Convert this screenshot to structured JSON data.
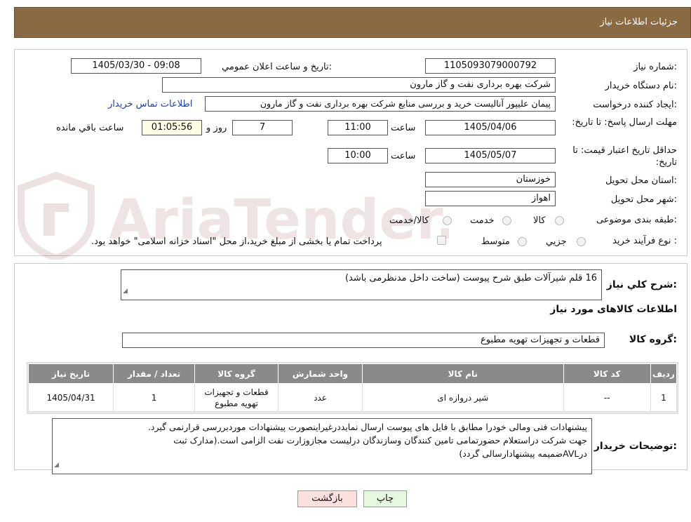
{
  "header": {
    "title": "جزئیات اطلاعات نیاز"
  },
  "watermark": {
    "text": "AriaTender.neT"
  },
  "form": {
    "need_number_label": "شماره نیاز:",
    "need_number": "1105093079000792",
    "announce_label": "تاریخ و ساعت اعلان عمومي:",
    "announce_value": "1405/03/30 - 09:08",
    "buyer_org_label": "نام دستگاه خریدار:",
    "buyer_org": "شرکت بهره برداری نفت و گاز مارون",
    "creator_label": "ایجاد کننده درخواست:",
    "creator": "پیمان علیپور آنالیست خرید و بررسی منابع شرکت بهره برداری نفت و گاز مارون",
    "contact_link": "اطلاعات تماس خریدار",
    "deadline_label": "مهلت ارسال پاسخ: تا تاریخ:",
    "deadline_date": "1405/04/06",
    "time_label": "ساعت",
    "deadline_time": "11:00",
    "days": "7",
    "days_label": "روز و",
    "remaining": "01:05:56",
    "remaining_label": "ساعت باقي مانده",
    "validity_label": "حداقل تاریخ اعتبار قیمت: تا تاریخ:",
    "validity_date": "1405/05/07",
    "validity_time": "10:00",
    "province_label": "استان محل تحویل:",
    "province": "خوزستان",
    "city_label": "شهر محل تحویل:",
    "city": "اهواز",
    "category_label": "طبقه بندی موضوعی:",
    "category_options": [
      "کالا",
      "خدمت",
      "کالا/خدمت"
    ],
    "process_label": "نوع فرآیند خرید :",
    "process_options": [
      "جزیي",
      "متوسط"
    ],
    "payment_note": "پرداخت تمام یا بخشی از مبلغ خرید،از محل \"اسناد خزانه اسلامی\" خواهد بود."
  },
  "summary": {
    "description_label": "شرح کلي نیاز:",
    "description": "16 قلم شیرآلات طبق شرح پیوست (ساخت داخل مدنظرمی باشد)",
    "goods_info_title": "اطلاعات کالاهای مورد نیاز",
    "goods_group_label": "گروه کالا:",
    "goods_group": "قطعات و تجهیزات تهویه مطبوع"
  },
  "table": {
    "headers": [
      "ردیف",
      "کد کالا",
      "نام کالا",
      "واحد شمارش",
      "گروه کالا",
      "تعداد / مقدار",
      "تاریخ نیاز"
    ],
    "rows": [
      [
        "1",
        "--",
        "شیر دروازه ای",
        "عدد",
        "قطعات و تجهیزات تهویه مطبوع",
        "1",
        "1405/04/31"
      ]
    ]
  },
  "notes": {
    "label": "توضیحات خریدار:",
    "line1": "پیشنهادات فنی ومالی خودرا  مطابق با فایل های پیوست ارسال نمایددرغیراینصورت پیشنهادات موردبررسی قرارنمی گیرد.",
    "line2": "جهت شرکت دراستعلام حضورتمامی تامین کنندگان وسازندگان درلیست مجازوزارت نفت الزامی است.(مدارک ثبت",
    "line3": "درAVLضمیمه پیشنهادارسالی گردد)"
  },
  "buttons": {
    "print": "چاپ",
    "back": "بازگشت"
  },
  "colors": {
    "header_bg": "#8a6a43",
    "table_header": "#8a8a8a",
    "print_btn": "#e6f8df",
    "back_btn": "#fbe0e0"
  }
}
